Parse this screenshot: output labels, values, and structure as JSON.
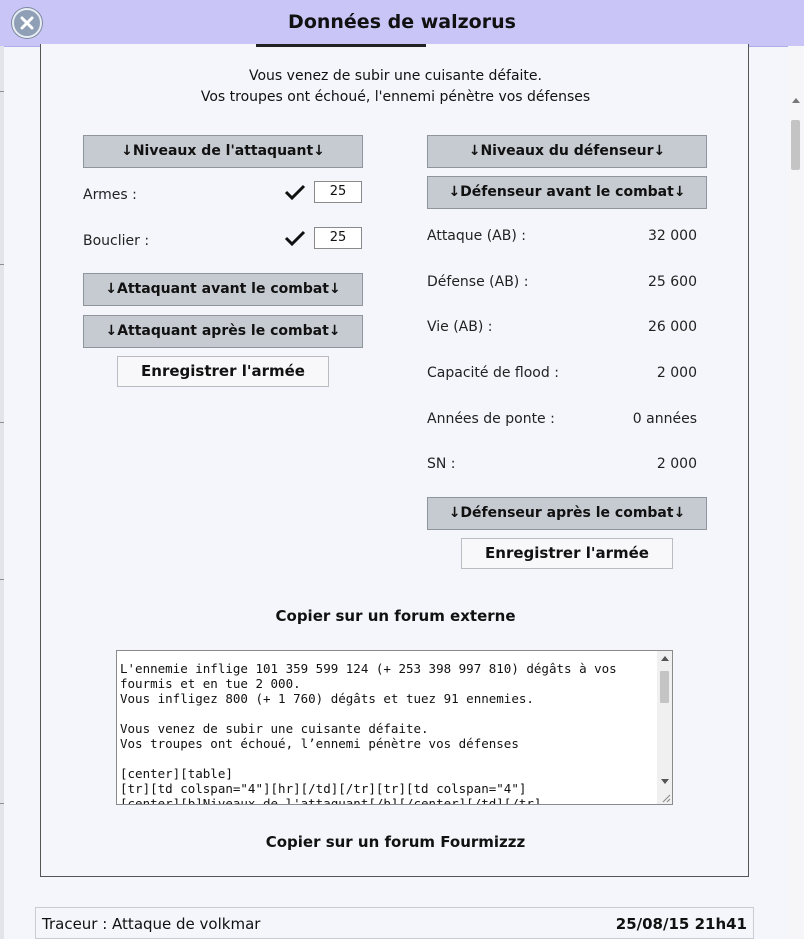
{
  "window": {
    "title": "Données de walzorus"
  },
  "message": {
    "line1": "Vous venez de subir une cuisante défaite.",
    "line2": "Vos troupes ont échoué, l'ennemi pénètre vos défenses"
  },
  "attacker": {
    "levels_button": "↓Niveaux de l'attaquant↓",
    "weapons_label": "Armes :",
    "weapons_value": "25",
    "shield_label": "Bouclier :",
    "shield_value": "25",
    "before_button": "↓Attaquant avant le combat↓",
    "after_button": "↓Attaquant après le combat↓",
    "save_button": "Enregistrer l'armée"
  },
  "defender": {
    "levels_button": "↓Niveaux du défenseur↓",
    "before_button": "↓Défenseur avant le combat↓",
    "stats": [
      {
        "label": "Attaque (AB) :",
        "value": "32 000"
      },
      {
        "label": "Défense (AB) :",
        "value": "25 600"
      },
      {
        "label": "Vie (AB) :",
        "value": "26 000"
      },
      {
        "label": "Capacité de flood :",
        "value": "2 000"
      },
      {
        "label": "Années de ponte :",
        "value": "0 années"
      },
      {
        "label": "SN :",
        "value": "2 000"
      }
    ],
    "after_button": "↓Défenseur après le combat↓",
    "save_button": "Enregistrer l'armée"
  },
  "export": {
    "external_title": "Copier sur un forum externe",
    "textarea_lines": [
      "",
      "L'ennemie inflige 101 359 599 124 (+ 253 398 997 810) dégâts à vos",
      "fourmis et en tue 2 000.",
      "Vous infligez 800 (+ 1 760) dégâts et tuez 91 ennemies.",
      "",
      "Vous venez de subir une cuisante défaite.",
      "Vos troupes ont échoué, l’ennemi pénètre vos défenses",
      "",
      "[center][table]",
      "[tr][td colspan=\"4\"][hr][/td][/tr][tr][td colspan=\"4\"]",
      "[center][b]Niveaux de l'attaquant[/b][/center][/td][/tr]"
    ],
    "fourmizzz_title": "Copier sur un forum Fourmizzz"
  },
  "tracer": {
    "label": "Traceur : Attaque de volkmar",
    "date": "25/08/15 21h41"
  },
  "colors": {
    "titlebar": "#c9c6f7",
    "button_gray": "#c6cbd1",
    "background": "#f4f6fb"
  }
}
